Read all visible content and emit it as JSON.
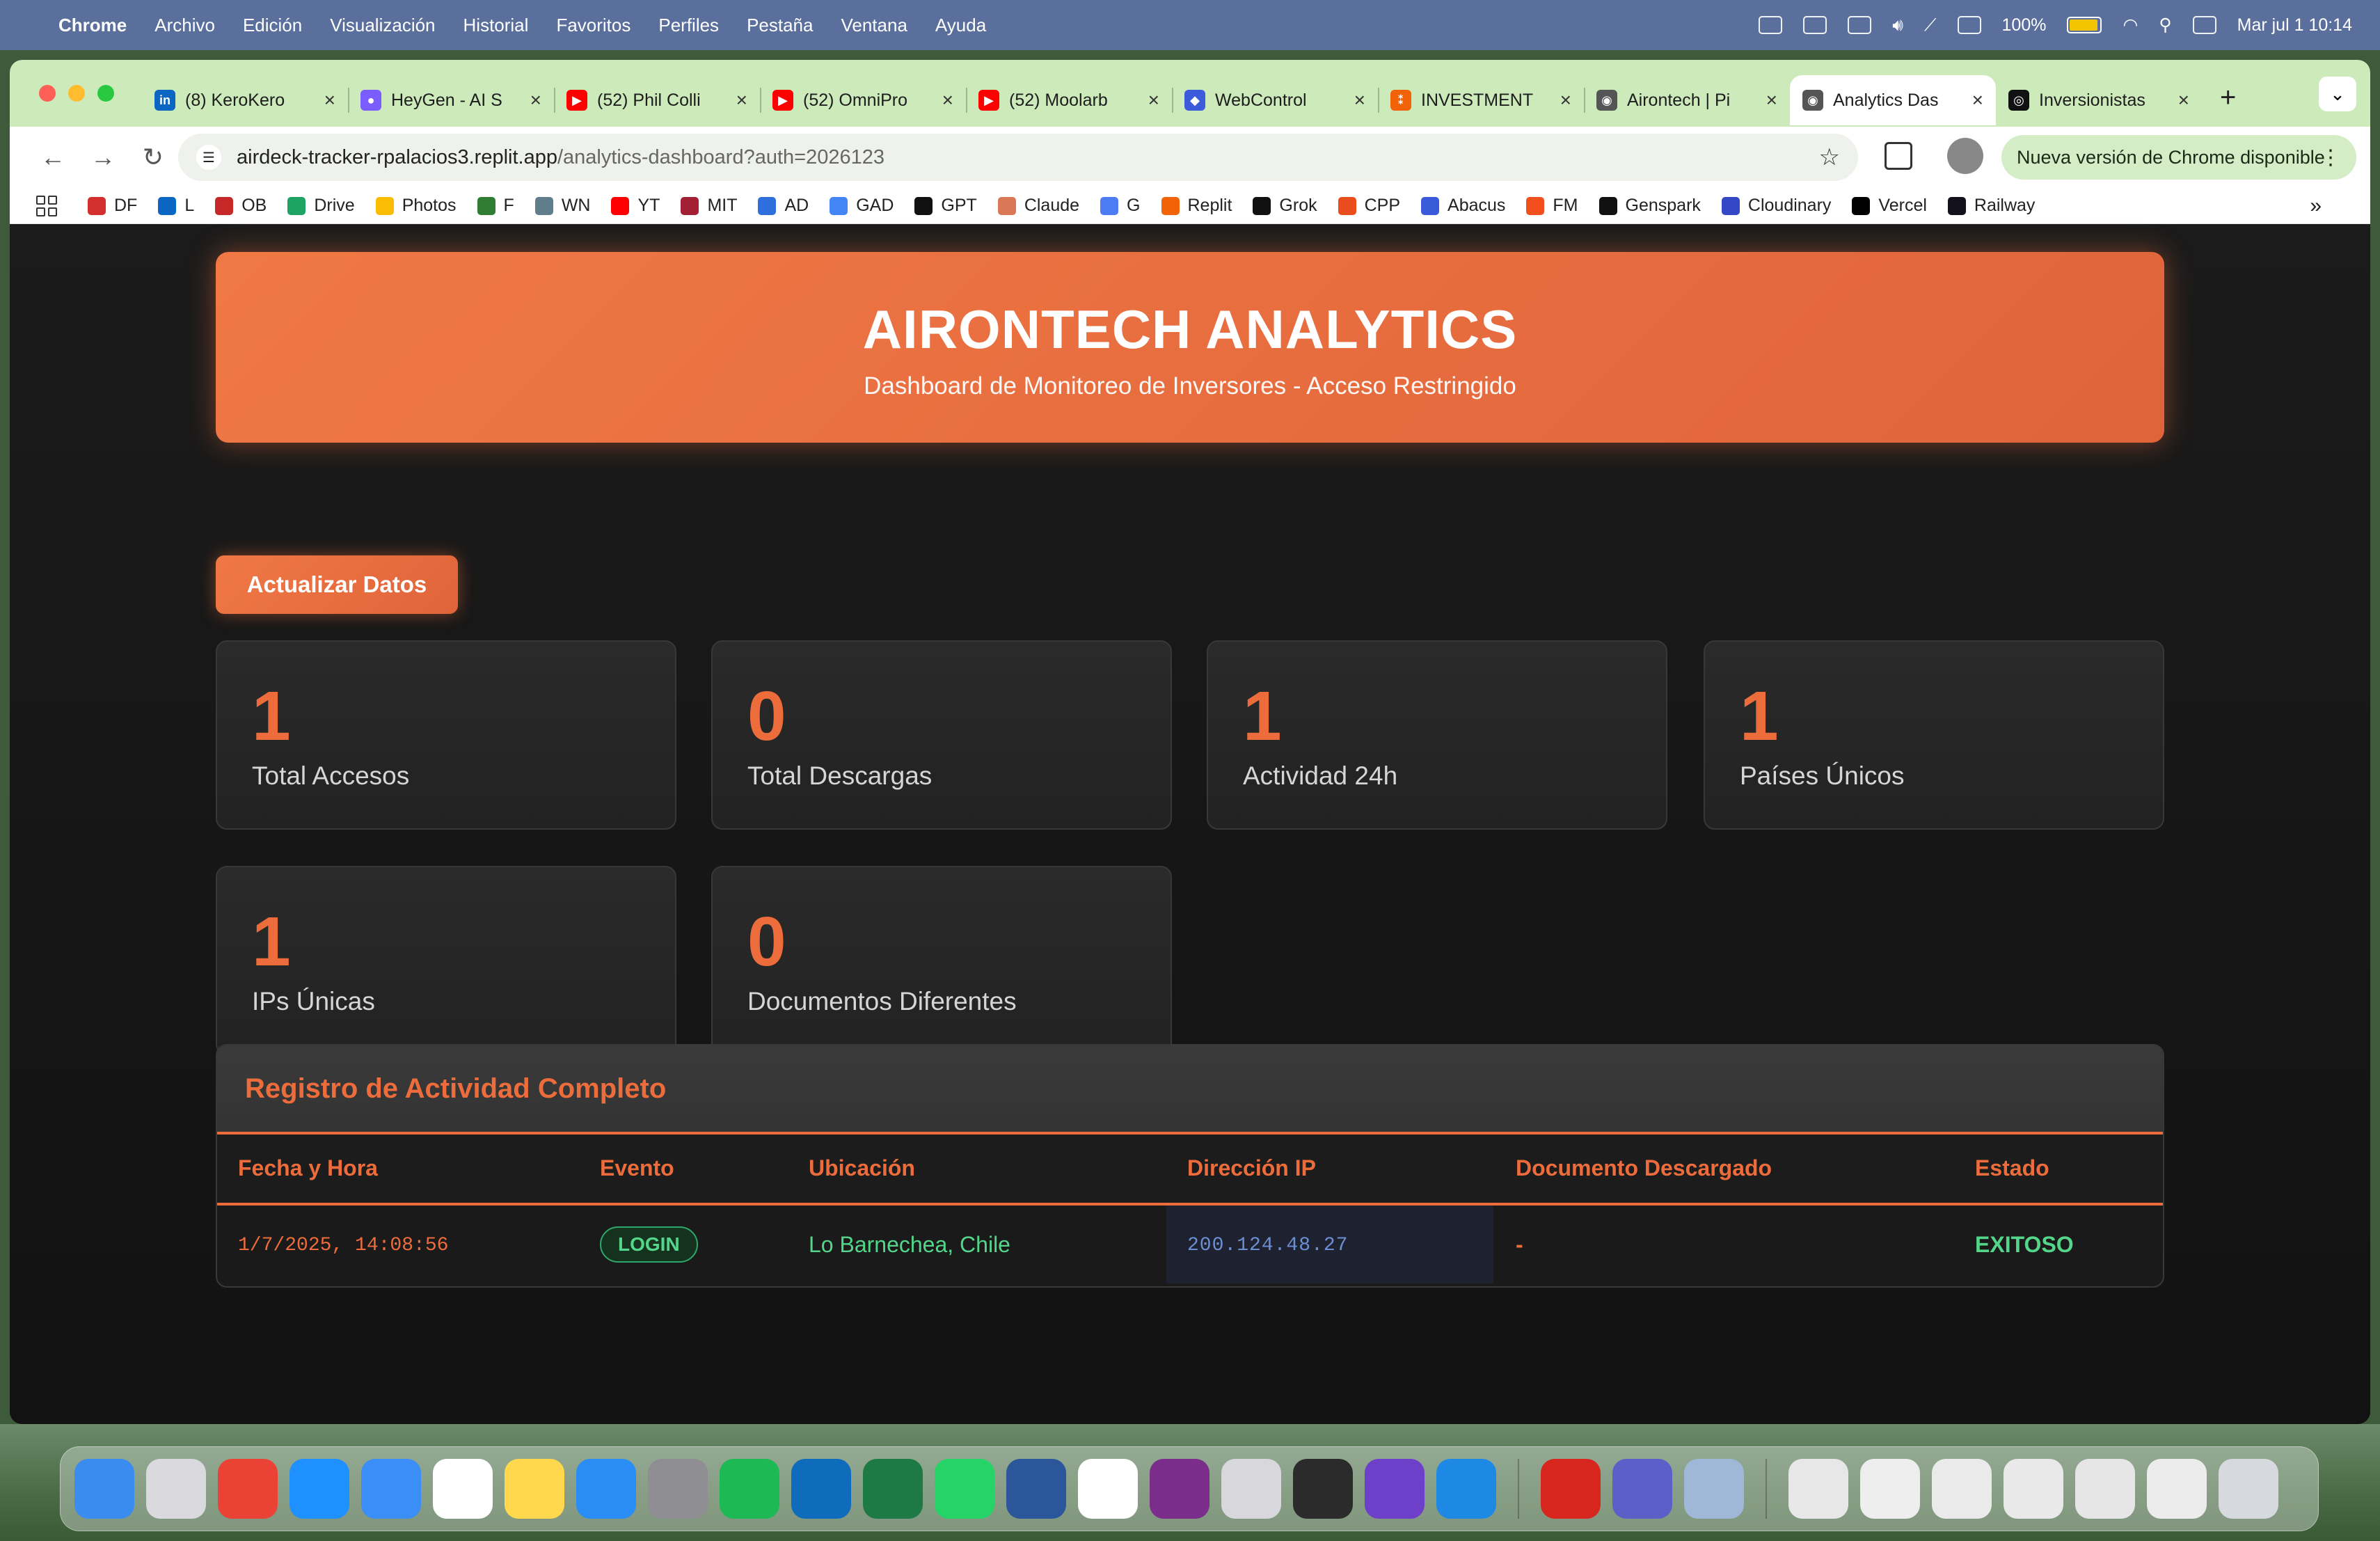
{
  "menubar": {
    "app": "Chrome",
    "items": [
      "Archivo",
      "Edición",
      "Visualización",
      "Historial",
      "Favoritos",
      "Perfiles",
      "Pestaña",
      "Ventana",
      "Ayuda"
    ],
    "battery": "100%",
    "clock": "Mar jul 1  10:14"
  },
  "tabs": [
    {
      "title": "(8) KeroKero",
      "color": "#0a66c2",
      "glyph": "in"
    },
    {
      "title": "HeyGen - AI S",
      "color": "#7b5cff",
      "glyph": "●"
    },
    {
      "title": "(52) Phil Colli",
      "color": "#ff0000",
      "glyph": "▶"
    },
    {
      "title": "(52) OmniPro",
      "color": "#ff0000",
      "glyph": "▶"
    },
    {
      "title": "(52) Moolarb",
      "color": "#ff0000",
      "glyph": "▶"
    },
    {
      "title": "WebControl",
      "color": "#3b5bdb",
      "glyph": "◆"
    },
    {
      "title": "INVESTMENT",
      "color": "#f26207",
      "glyph": "⁑"
    },
    {
      "title": "Airontech | Pi",
      "color": "#555555",
      "glyph": "◉"
    },
    {
      "title": "Analytics Das",
      "color": "#555555",
      "glyph": "◉",
      "active": true
    },
    {
      "title": "Inversionistas",
      "color": "#111111",
      "glyph": "◎"
    }
  ],
  "toolbar": {
    "url_host": "airdeck-tracker-rpalacios3.replit.app",
    "url_path": "/analytics-dashboard?auth=2026123",
    "update_label": "Nueva versión de Chrome disponible"
  },
  "bookmarks": [
    {
      "label": "DF",
      "color": "#d32f2f"
    },
    {
      "label": "L",
      "color": "#0a66c2"
    },
    {
      "label": "OB",
      "color": "#c62828"
    },
    {
      "label": "Drive",
      "color": "#1ea362"
    },
    {
      "label": "Photos",
      "color": "#fbbc04"
    },
    {
      "label": "F",
      "color": "#2e7d32"
    },
    {
      "label": "WN",
      "color": "#607d8b"
    },
    {
      "label": "YT",
      "color": "#ff0000"
    },
    {
      "label": "MIT",
      "color": "#a31f34"
    },
    {
      "label": "AD",
      "color": "#2f6fdd"
    },
    {
      "label": "GAD",
      "color": "#4285f4"
    },
    {
      "label": "GPT",
      "color": "#111111"
    },
    {
      "label": "Claude",
      "color": "#d97757"
    },
    {
      "label": "G",
      "color": "#4c7cf3"
    },
    {
      "label": "Replit",
      "color": "#f26207"
    },
    {
      "label": "Grok",
      "color": "#111111"
    },
    {
      "label": "CPP",
      "color": "#ea4c1d"
    },
    {
      "label": "Abacus",
      "color": "#3a5bd9"
    },
    {
      "label": "FM",
      "color": "#f24e1e"
    },
    {
      "label": "Genspark",
      "color": "#111111"
    },
    {
      "label": "Cloudinary",
      "color": "#3448c5"
    },
    {
      "label": "Vercel",
      "color": "#000000"
    },
    {
      "label": "Railway",
      "color": "#13111c"
    }
  ],
  "header": {
    "title": "AIRONTECH ANALYTICS",
    "subtitle": "Dashboard de Monitoreo de Inversores - Acceso Restringido"
  },
  "refresh_label": "Actualizar Datos",
  "stats": [
    {
      "value": "1",
      "label": "Total Accesos"
    },
    {
      "value": "0",
      "label": "Total Descargas"
    },
    {
      "value": "1",
      "label": "Actividad 24h"
    },
    {
      "value": "1",
      "label": "Países Únicos"
    },
    {
      "value": "1",
      "label": "IPs Únicas"
    },
    {
      "value": "0",
      "label": "Documentos Diferentes"
    }
  ],
  "log": {
    "title": "Registro de Actividad Completo",
    "columns": [
      "Fecha y Hora",
      "Evento",
      "Ubicación",
      "Dirección IP",
      "Documento Descargado",
      "Estado"
    ],
    "rows": [
      {
        "date": "1/7/2025, 14:08:56",
        "event": "LOGIN",
        "location": "Lo Barnechea, Chile",
        "ip": "200.124.48.27",
        "document": "-",
        "status": "EXITOSO"
      }
    ]
  },
  "accent_color": "#ec6c3c",
  "success_color": "#54d68a",
  "dock": [
    {
      "name": "finder",
      "color": "#3b8cf0"
    },
    {
      "name": "launchpad",
      "color": "#d9d9de"
    },
    {
      "name": "chrome",
      "color": "#ea4335"
    },
    {
      "name": "safari",
      "color": "#1e90ff"
    },
    {
      "name": "mail",
      "color": "#3a8ef5"
    },
    {
      "name": "calendar",
      "color": "#ffffff"
    },
    {
      "name": "notes",
      "color": "#ffd84d"
    },
    {
      "name": "keynote",
      "color": "#2a8cf5"
    },
    {
      "name": "system-settings",
      "color": "#8e8e93"
    },
    {
      "name": "spotify",
      "color": "#1db954"
    },
    {
      "name": "outlook",
      "color": "#0f6cbd"
    },
    {
      "name": "excel",
      "color": "#1d7a45"
    },
    {
      "name": "whatsapp",
      "color": "#25d366"
    },
    {
      "name": "word",
      "color": "#2b579a"
    },
    {
      "name": "calendar-31",
      "color": "#ffffff"
    },
    {
      "name": "podcast-ring",
      "color": "#7b2d8b"
    },
    {
      "name": "iphone-mirroring",
      "color": "#d8d8dc"
    },
    {
      "name": "replit",
      "color": "#2b2b2b"
    },
    {
      "name": "github-desktop",
      "color": "#6e40c9"
    },
    {
      "name": "vscode",
      "color": "#1e88e5"
    },
    {
      "name": "acrobat",
      "color": "#d7261e"
    },
    {
      "name": "teams",
      "color": "#5b5fc7"
    },
    {
      "name": "preview",
      "color": "#9fb8d8"
    },
    {
      "name": "doc-1",
      "color": "#e7e7e7"
    },
    {
      "name": "doc-2",
      "color": "#eeeeee"
    },
    {
      "name": "doc-3",
      "color": "#eaeaea"
    },
    {
      "name": "doc-4",
      "color": "#e9e9e9"
    },
    {
      "name": "doc-5",
      "color": "#e6e6e6"
    },
    {
      "name": "doc-6",
      "color": "#ececec"
    },
    {
      "name": "trash",
      "color": "#d6dade"
    }
  ]
}
